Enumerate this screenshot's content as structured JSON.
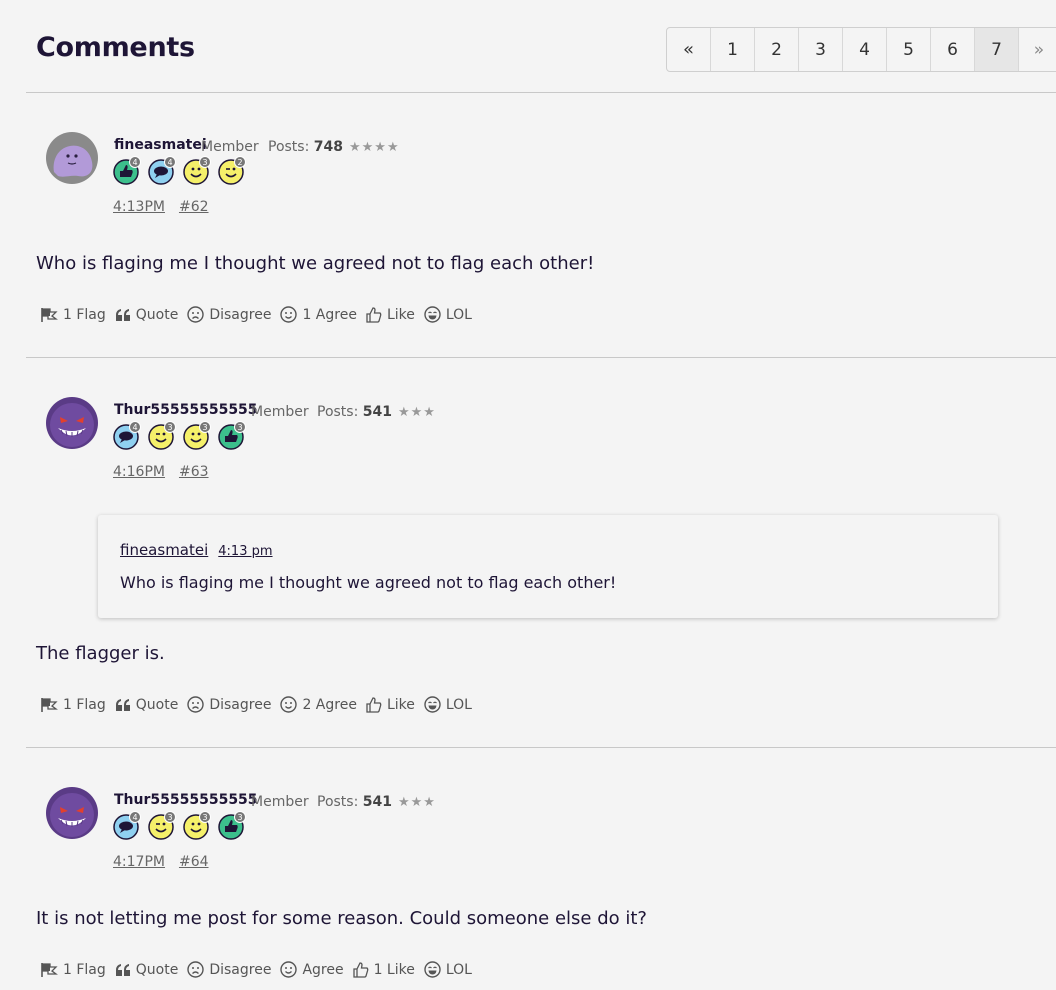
{
  "header": {
    "title": "Comments"
  },
  "pager": {
    "prev": "«",
    "pages": [
      "1",
      "2",
      "3",
      "4",
      "5",
      "6",
      "7"
    ],
    "active": "7",
    "next": "»"
  },
  "comments": [
    {
      "username": "fineasmatei",
      "role": "Member",
      "posts_label": "Posts:",
      "posts": "748",
      "stars": "★★★★",
      "badges": [
        {
          "icon": "thumbs-up-green-badge-icon",
          "count": "4"
        },
        {
          "icon": "speech-bubble-blue-badge-icon",
          "count": "4"
        },
        {
          "icon": "smile-yellow-badge-icon",
          "count": "3"
        },
        {
          "icon": "wink-yellow-badge-icon",
          "count": "2"
        }
      ],
      "time": "4:13PM",
      "number": "#62",
      "text": "Who is flaging me I thought we agreed not to flag each other!",
      "actions": {
        "flag": "1 Flag",
        "quote": "Quote",
        "disagree": "Disagree",
        "agree": "1 Agree",
        "like": "Like",
        "lol": "LOL"
      }
    },
    {
      "username": "Thur55555555555",
      "role": "Member",
      "posts_label": "Posts:",
      "posts": "541",
      "stars": "★★★",
      "badges": [
        {
          "icon": "speech-bubble-blue-badge-icon",
          "count": "4"
        },
        {
          "icon": "wink-yellow-badge-icon",
          "count": "3"
        },
        {
          "icon": "smile-yellow-badge-icon",
          "count": "3"
        },
        {
          "icon": "thumbs-up-green-badge-icon",
          "count": "3"
        }
      ],
      "time": "4:16PM",
      "number": "#63",
      "quote": {
        "author": "fineasmatei",
        "time": "4:13 pm",
        "text": "Who is flaging me I thought we agreed not to flag each other!"
      },
      "text": "The flagger is.",
      "actions": {
        "flag": "1 Flag",
        "quote": "Quote",
        "disagree": "Disagree",
        "agree": "2 Agree",
        "like": "Like",
        "lol": "LOL"
      }
    },
    {
      "username": "Thur55555555555",
      "role": "Member",
      "posts_label": "Posts:",
      "posts": "541",
      "stars": "★★★",
      "badges": [
        {
          "icon": "speech-bubble-blue-badge-icon",
          "count": "4"
        },
        {
          "icon": "wink-yellow-badge-icon",
          "count": "3"
        },
        {
          "icon": "smile-yellow-badge-icon",
          "count": "3"
        },
        {
          "icon": "thumbs-up-green-badge-icon",
          "count": "3"
        }
      ],
      "time": "4:17PM",
      "number": "#64",
      "text": "It is not letting me post for some reason. Could someone else do it?",
      "actions": {
        "flag": "1 Flag",
        "quote": "Quote",
        "disagree": "Disagree",
        "agree": "Agree",
        "like": "1 Like",
        "lol": "LOL"
      }
    }
  ],
  "colors": {
    "background": "#f4f4f4",
    "text": "#1e1536",
    "muted": "#666666",
    "badge_green": "#3cbf8c",
    "badge_blue": "#8fd0f0",
    "badge_yellow": "#f5f06a"
  }
}
